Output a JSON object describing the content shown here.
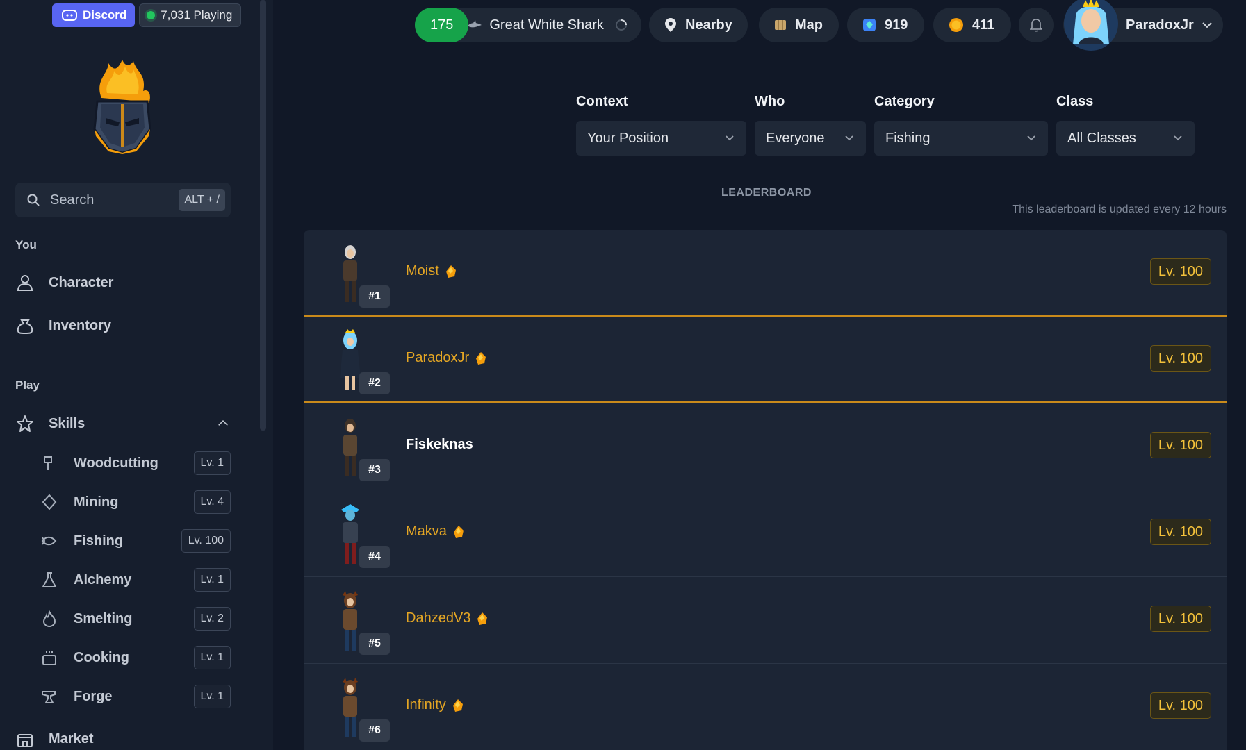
{
  "sidebar": {
    "discord_label": "Discord",
    "playing_label": "7,031 Playing",
    "search_placeholder": "Search",
    "search_shortcut": "ALT + /",
    "section_you": "You",
    "character_label": "Character",
    "inventory_label": "Inventory",
    "section_play": "Play",
    "skills_label": "Skills",
    "skills": [
      {
        "name": "Woodcutting",
        "level": "Lv. 1",
        "icon": "axe-icon"
      },
      {
        "name": "Mining",
        "level": "Lv. 4",
        "icon": "gem-icon"
      },
      {
        "name": "Fishing",
        "level": "Lv. 100",
        "icon": "fish-icon"
      },
      {
        "name": "Alchemy",
        "level": "Lv. 1",
        "icon": "flask-icon"
      },
      {
        "name": "Smelting",
        "level": "Lv. 2",
        "icon": "flame-icon"
      },
      {
        "name": "Cooking",
        "level": "Lv. 1",
        "icon": "pot-icon"
      },
      {
        "name": "Forge",
        "level": "Lv. 1",
        "icon": "anvil-icon"
      }
    ],
    "market_label": "Market"
  },
  "topbar": {
    "activity_level": "175",
    "activity_name": "Great White Shark",
    "nearby_label": "Nearby",
    "map_label": "Map",
    "gems": "919",
    "gold": "411",
    "username": "ParadoxJr"
  },
  "filters": {
    "context_label": "Context",
    "context_value": "Your Position",
    "who_label": "Who",
    "who_value": "Everyone",
    "category_label": "Category",
    "category_value": "Fishing",
    "class_label": "Class",
    "class_value": "All Classes"
  },
  "leaderboard": {
    "title": "LEADERBOARD",
    "note": "This leaderboard is updated every 12 hours",
    "rows": [
      {
        "rank": "#1",
        "name": "Moist",
        "level": "Lv. 100"
      },
      {
        "rank": "#2",
        "name": "ParadoxJr",
        "level": "Lv. 100"
      },
      {
        "rank": "#3",
        "name": "Fiskeknas",
        "level": "Lv. 100"
      },
      {
        "rank": "#4",
        "name": "Makva",
        "level": "Lv. 100"
      },
      {
        "rank": "#5",
        "name": "DahzedV3",
        "level": "Lv. 100"
      },
      {
        "rank": "#6",
        "name": "Infinity",
        "level": "Lv. 100"
      }
    ]
  },
  "colors": {
    "accent_gold": "#e4a624",
    "discord": "#5865f2",
    "online_green": "#22c55e"
  }
}
